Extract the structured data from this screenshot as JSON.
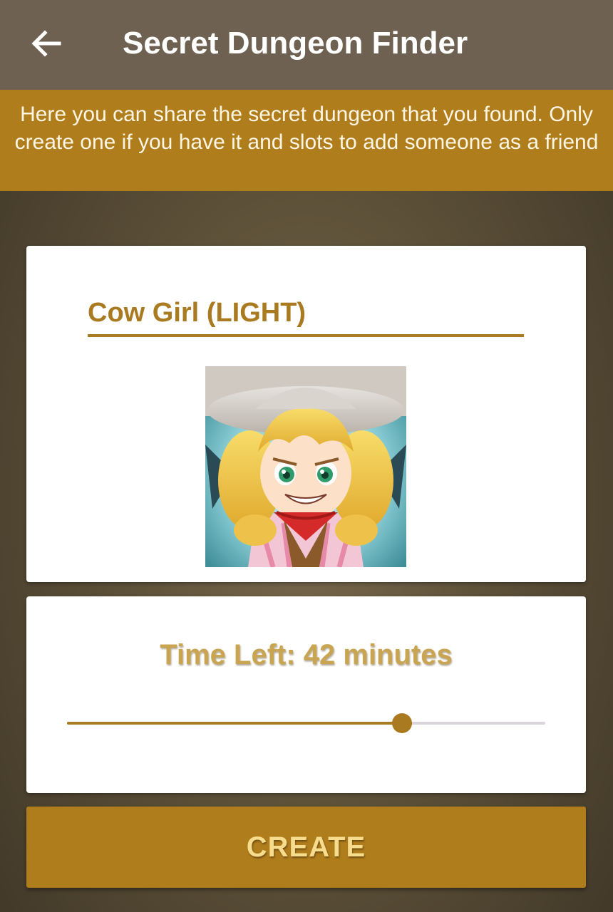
{
  "appbar": {
    "title": "Secret Dungeon Finder",
    "back_icon": "arrow-left-icon"
  },
  "banner": {
    "text": "Here you can share the secret dungeon that you found. Only create one if you have it and slots to add someone as a friend"
  },
  "monster": {
    "name": "Cow Girl (LIGHT)",
    "portrait_icon": "cow-girl-portrait"
  },
  "timer": {
    "label": "Time Left: 42 minutes",
    "slider_fraction": 0.7
  },
  "actions": {
    "create_label": "CREATE"
  },
  "colors": {
    "appbar": "#6f6151",
    "accent": "#b07d1c",
    "gold_text": "#a97a1f",
    "track": "#d9d4dc"
  }
}
